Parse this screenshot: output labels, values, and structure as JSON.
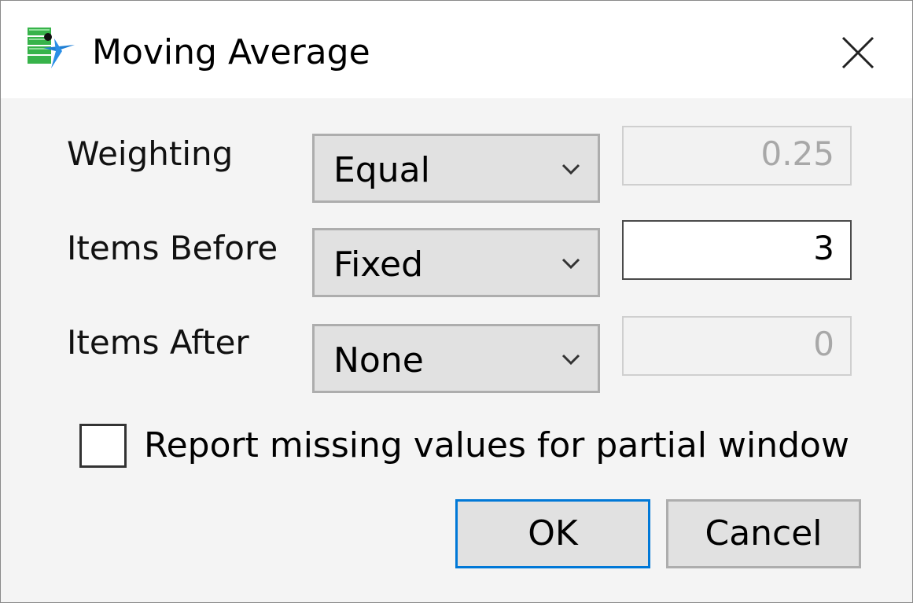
{
  "window": {
    "title": "Moving Average",
    "app_icon": "jmp-spreadsheet-icon",
    "close_icon": "close-icon"
  },
  "rows": [
    {
      "label": "Weighting",
      "selected": "Equal",
      "value": "0.25",
      "value_enabled": false
    },
    {
      "label": "Items Before",
      "selected": "Fixed",
      "value": "3",
      "value_enabled": true
    },
    {
      "label": "Items After",
      "selected": "None",
      "value": "0",
      "value_enabled": false
    }
  ],
  "options": {
    "report_missing_label": "Report missing values for partial window",
    "report_missing_checked": false
  },
  "buttons": {
    "ok_label": "OK",
    "cancel_label": "Cancel"
  },
  "colors": {
    "focus_border": "#0078d7",
    "button_bg": "#e1e1e1",
    "disabled_text": "#a8a8a8"
  }
}
